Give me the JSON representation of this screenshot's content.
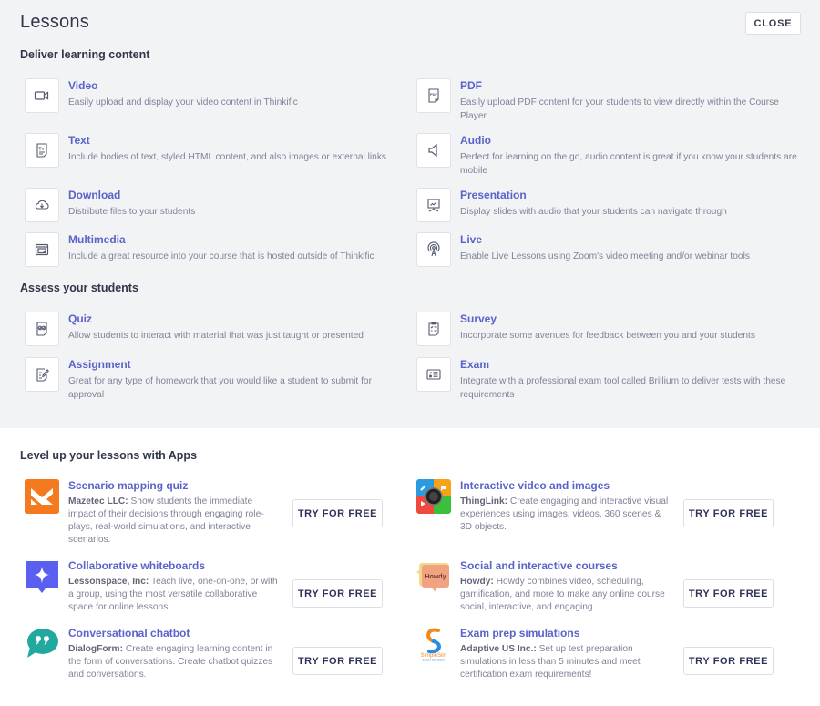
{
  "header": {
    "title": "Lessons",
    "close_label": "CLOSE"
  },
  "deliver": {
    "heading": "Deliver learning content",
    "items": [
      {
        "icon": "video-camera-icon",
        "name": "Video",
        "desc": "Easily upload and display your video content in Thinkific"
      },
      {
        "icon": "pdf-file-icon",
        "name": "PDF",
        "desc": "Easily upload PDF content for your students to view directly within the Course Player"
      },
      {
        "icon": "text-document-icon",
        "name": "Text",
        "desc": "Include bodies of text, styled HTML content, and also images or external links"
      },
      {
        "icon": "speaker-icon",
        "name": "Audio",
        "desc": "Perfect for learning on the go, audio content is great if you know your students are mobile"
      },
      {
        "icon": "cloud-download-icon",
        "name": "Download",
        "desc": "Distribute files to your students"
      },
      {
        "icon": "presentation-board-icon",
        "name": "Presentation",
        "desc": "Display slides with audio that your students can navigate through"
      },
      {
        "icon": "multimedia-window-icon",
        "name": "Multimedia",
        "desc": "Include a great resource into your course that is hosted outside of Thinkific"
      },
      {
        "icon": "broadcast-antenna-icon",
        "name": "Live",
        "desc": "Enable Live Lessons using Zoom's video meeting and/or webinar tools"
      }
    ]
  },
  "assess": {
    "heading": "Assess your students",
    "items": [
      {
        "icon": "quiz-icon",
        "name": "Quiz",
        "desc": "Allow students to interact with material that was just taught or presented"
      },
      {
        "icon": "clipboard-checklist-icon",
        "name": "Survey",
        "desc": "Incorporate some avenues for feedback between you and your students"
      },
      {
        "icon": "pencil-document-icon",
        "name": "Assignment",
        "desc": "Great for any type of homework that you would like a student to submit for approval"
      },
      {
        "icon": "exam-list-icon",
        "name": "Exam",
        "desc": "Integrate with a professional exam tool called Brillium to deliver tests with these requirements"
      }
    ]
  },
  "apps": {
    "heading": "Level up your lessons with Apps",
    "button_label": "TRY FOR FREE",
    "items": [
      {
        "logo": "mazetec-logo-icon",
        "name": "Scenario mapping quiz",
        "vendor": "Mazetec LLC:",
        "desc": "Show students the immediate impact of their decisions through engaging role-plays, real-world simulations, and interactive scenarios.",
        "color": "#f57a1f"
      },
      {
        "logo": "thinglink-logo-icon",
        "name": "Interactive video and images",
        "vendor": "ThingLink:",
        "desc": "Create engaging and interactive visual experiences using images, videos, 360 scenes & 3D objects.",
        "color": "#2a9be0"
      },
      {
        "logo": "lessonspace-logo-icon",
        "name": "Collaborative whiteboards",
        "vendor": "Lessonspace, Inc:",
        "desc": "Teach live, one-on-one, or with a group, using the most versatile collaborative space for online lessons.",
        "color": "#5b5ff0"
      },
      {
        "logo": "howdy-logo-icon",
        "name": "Social and interactive courses",
        "vendor": "Howdy:",
        "desc": "Howdy combines video, scheduling, gamification, and more to make any online course social, interactive, and engaging.",
        "color": "#f0a37a",
        "logo_text": "Howdy"
      },
      {
        "logo": "dialogform-logo-icon",
        "name": "Conversational chatbot",
        "vendor": "DialogForm:",
        "desc": "Create engaging learning content in the form of conversations. Create chatbot quizzes and conversations.",
        "color": "#22a99f"
      },
      {
        "logo": "simplesim-logo-icon",
        "name": "Exam prep simulations",
        "vendor": "Adaptive US Inc.:",
        "desc": "Set up test preparation simulations in less than 5 minutes and meet certification exam requirements!",
        "color": "#f08a1f",
        "logo_text": "SimpleSim",
        "logo_subtext": "Exam Simulator"
      }
    ]
  }
}
